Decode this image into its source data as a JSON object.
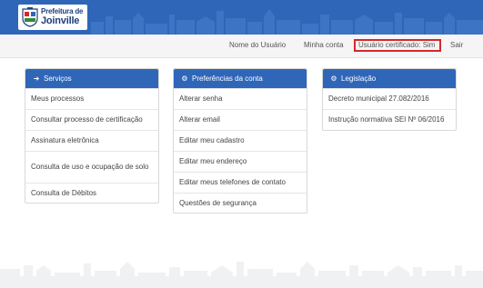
{
  "logo": {
    "line1": "Prefeitura de",
    "line2": "Joinville"
  },
  "topnav": {
    "username": "Nome do Usuário",
    "my_account": "Minha conta",
    "certified_user": "Usuário certificado: Sim",
    "exit": "Sair"
  },
  "panels": [
    {
      "title": "Serviços",
      "icon": "sign-in-icon",
      "items": [
        "Meus processos",
        "Consultar processo de certificação",
        "Assinatura eletrônica",
        "Consulta de uso e ocupação de solo",
        "Consulta de Débitos"
      ]
    },
    {
      "title": "Preferências da conta",
      "icon": "gear-icon",
      "items": [
        "Alterar senha",
        "Alterar email",
        "Editar meu cadastro",
        "Editar meu endereço",
        "Editar meus telefones de contato",
        "Questões de segurança"
      ]
    },
    {
      "title": "Legislação",
      "icon": "gear-icon",
      "items": [
        "Decreto municipal 27.082/2016",
        "Instrução normativa SEI Nº 06/2016"
      ]
    }
  ],
  "colors": {
    "brand_blue": "#2f66b8",
    "highlight_red": "#d9262a"
  }
}
